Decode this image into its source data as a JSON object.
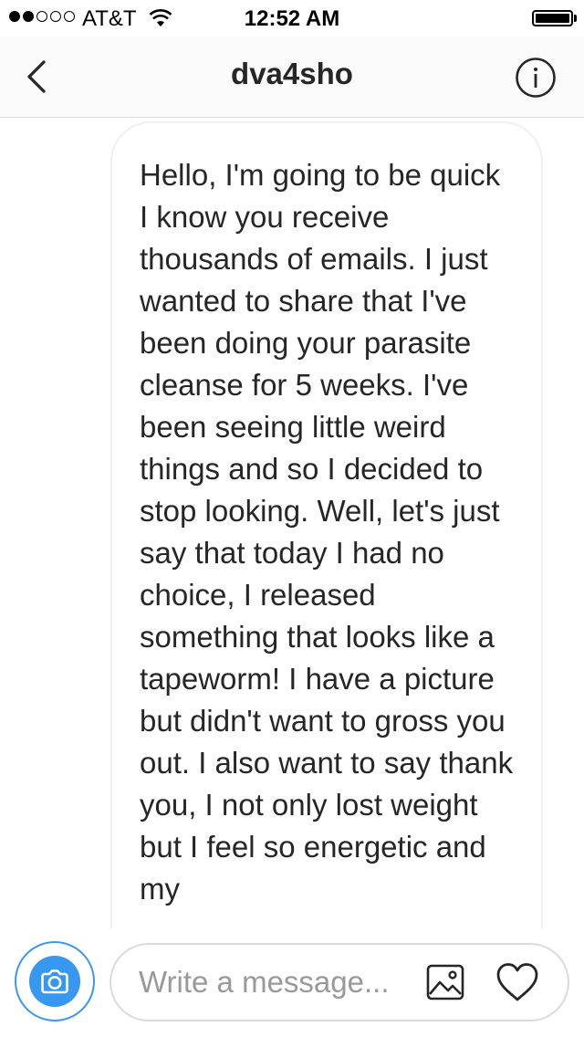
{
  "status_bar": {
    "carrier": "AT&T",
    "time": "12:52 AM",
    "signal_bars_filled": 2,
    "signal_bars_total": 5,
    "icons": [
      "wifi-icon",
      "battery-icon"
    ]
  },
  "header": {
    "title": "dva4sho",
    "back_icon": "chevron-left-icon",
    "info_icon": "info-icon"
  },
  "messages": [
    {
      "text": "Hello, I'm going to be quick I know you receive thousands of emails. I just wanted to share that I've been doing your parasite cleanse for 5 weeks. I've been seeing little weird things and so I decided to stop looking. Well, let's just say that today I had no choice, I released something that looks like a tapeworm! I have a picture but didn't want to gross you out. I also want to say thank you, I not only lost weight but I feel so energetic and my"
    }
  ],
  "composer": {
    "placeholder": "Write a message...",
    "value": "",
    "icons": [
      "camera-icon",
      "gallery-icon",
      "heart-icon"
    ]
  },
  "colors": {
    "accent": "#3897f0",
    "border": "#dbdbdb",
    "text": "#262626",
    "placeholder": "#999999"
  }
}
